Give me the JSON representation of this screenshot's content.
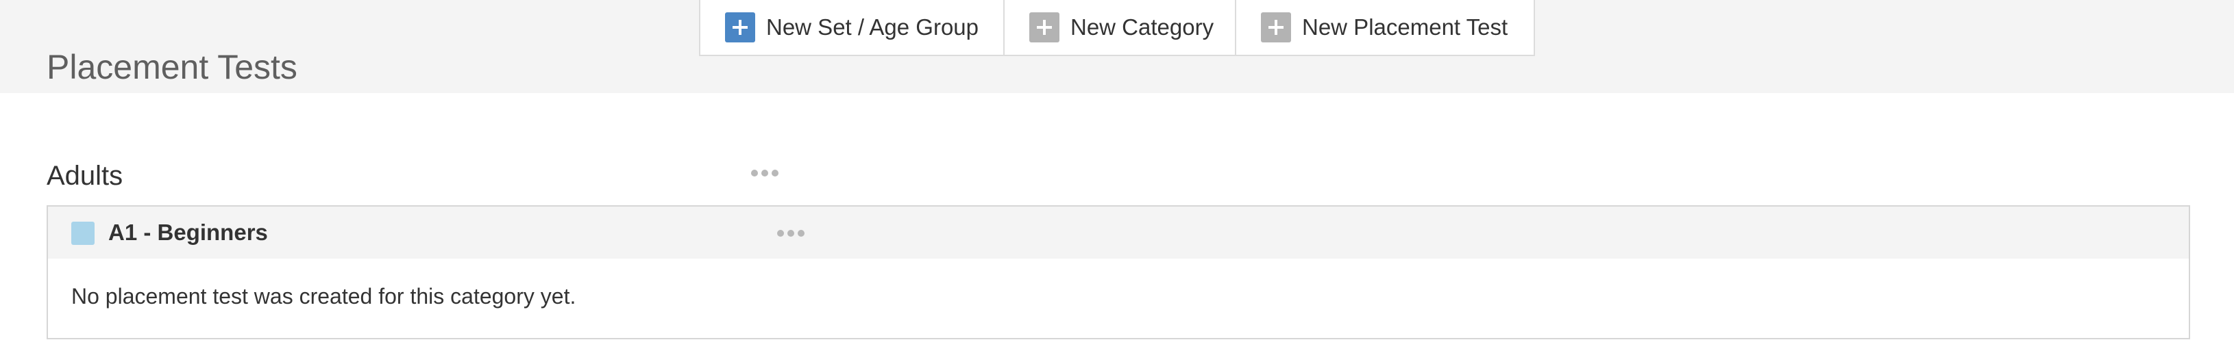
{
  "header": {
    "title": "Placement Tests"
  },
  "toolbar": {
    "buttons": [
      {
        "label": "New Set / Age Group",
        "icon": "plus-icon",
        "color": "#4a86c5"
      },
      {
        "label": "New Category",
        "icon": "plus-icon",
        "color": "#b3b3b3"
      },
      {
        "label": "New Placement Test",
        "icon": "plus-icon",
        "color": "#b3b3b3"
      }
    ]
  },
  "groups": [
    {
      "title": "Adults",
      "menu_icon": "more-horizontal-icon",
      "categories": [
        {
          "title": "A1 - Beginners",
          "color": "#a9d4ea",
          "menu_icon": "more-horizontal-icon",
          "empty_message": "No placement test was created for this category yet."
        }
      ]
    }
  ]
}
